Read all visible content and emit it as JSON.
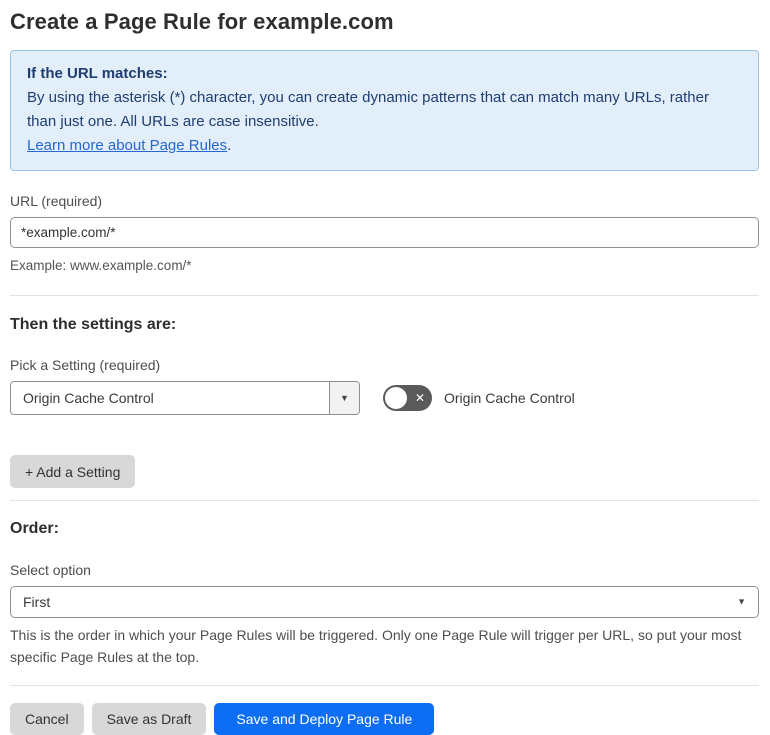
{
  "page": {
    "title": "Create a Page Rule for example.com"
  },
  "info_box": {
    "heading": "If the URL matches:",
    "body": "By using the asterisk (*) character, you can create dynamic patterns that can match many URLs, rather than just one. All URLs are case insensitive.",
    "link_label": "Learn more about Page Rules",
    "link_suffix": "."
  },
  "url_section": {
    "label": "URL (required)",
    "input_value": "*example.com/*",
    "helper": "Example: www.example.com/*"
  },
  "settings_section": {
    "heading": "Then the settings are:",
    "picker_label": "Pick a Setting (required)",
    "selected_setting": "Origin Cache Control",
    "toggle_label": "Origin Cache Control",
    "toggle_state": "off",
    "add_setting_label": "+ Add a Setting"
  },
  "order_section": {
    "heading": "Order:",
    "select_label": "Select option",
    "selected_option": "First",
    "helper": "This is the order in which your Page Rules will be triggered. Only one Page Rule will trigger per URL, so put your most specific Page Rules at the top."
  },
  "footer": {
    "cancel_label": "Cancel",
    "save_draft_label": "Save as Draft",
    "save_deploy_label": "Save and Deploy Page Rule"
  },
  "icons": {
    "dropdown_arrow": "▼",
    "toggle_off_x": "✕"
  },
  "colors": {
    "accent_blue": "#0d6ef4",
    "info_background": "#e3eefb",
    "info_border": "#9cc2e5",
    "info_text": "#1e3e6e",
    "link_blue": "#2668cd",
    "toggle_off_background": "#5a5a5a",
    "button_gray": "#d8d8d8"
  }
}
